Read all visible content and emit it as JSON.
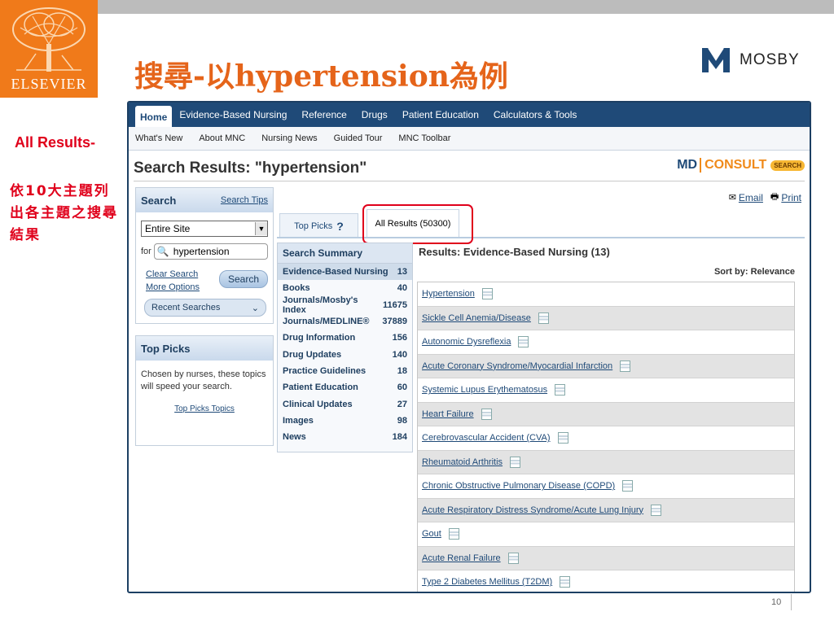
{
  "slide": {
    "title": "搜尋-以hypertension為例",
    "elsevier_label": "ELSEVIER",
    "mosby_label": "MOSBY",
    "side_note_1": "All Results-",
    "side_note_2": "依10大主題列出各主題之搜尋結果",
    "page_number": "10"
  },
  "app": {
    "main_nav": [
      "Home",
      "Evidence-Based Nursing",
      "Reference",
      "Drugs",
      "Patient Education",
      "Calculators & Tools"
    ],
    "sub_nav": [
      "What's New",
      "About MNC",
      "Nursing News",
      "Guided Tour",
      "MNC Toolbar"
    ],
    "page_heading": "Search Results: \"hypertension\"",
    "brand": {
      "md": "MD",
      "consult": "CONSULT",
      "search_badge": "SEARCH"
    },
    "email_label": "Email",
    "print_label": "Print"
  },
  "search_panel": {
    "title": "Search",
    "tips_link": "Search Tips",
    "scope": "Entire Site",
    "for_label": "for",
    "query": "hypertension",
    "clear_search": "Clear Search",
    "more_options": "More Options",
    "search_button": "Search",
    "recent_searches": "Recent Searches"
  },
  "top_picks": {
    "title": "Top Picks",
    "description": "Chosen by nurses, these topics will speed your search.",
    "link": "Top Picks Topics"
  },
  "tabs": {
    "top_picks_tab": "Top Picks",
    "all_results_tab": "All Results (50300)"
  },
  "summary": {
    "title": "Search Summary",
    "rows": [
      {
        "label": "Evidence-Based Nursing",
        "count": "13"
      },
      {
        "label": "Books",
        "count": "40"
      },
      {
        "label": "Journals/Mosby's Index",
        "count": "11675"
      },
      {
        "label": "Journals/MEDLINE®",
        "count": "37889"
      },
      {
        "label": "Drug Information",
        "count": "156"
      },
      {
        "label": "Drug Updates",
        "count": "140"
      },
      {
        "label": "Practice Guidelines",
        "count": "18"
      },
      {
        "label": "Patient Education",
        "count": "60"
      },
      {
        "label": "Clinical Updates",
        "count": "27"
      },
      {
        "label": "Images",
        "count": "98"
      },
      {
        "label": "News",
        "count": "184"
      }
    ]
  },
  "results": {
    "title": "Results: Evidence-Based Nursing (13)",
    "sort_by": "Sort by: Relevance",
    "items": [
      "Hypertension",
      "Sickle Cell Anemia/Disease",
      "Autonomic Dysreflexia",
      "Acute Coronary Syndrome/Myocardial Infarction",
      "Systemic Lupus Erythematosus",
      "Heart Failure",
      "Cerebrovascular Accident (CVA)",
      "Rheumatoid Arthritis",
      "Chronic Obstructive Pulmonary Disease (COPD)",
      "Acute Respiratory Distress Syndrome/Acute Lung Injury",
      "Gout",
      "Acute Renal Failure",
      "Type 2 Diabetes Mellitus (T2DM)"
    ]
  },
  "colors": {
    "elsevier_orange": "#f07a1a",
    "title_orange": "#e5641a",
    "highlight_red": "#e0001b",
    "nav_blue": "#1f4a78"
  }
}
